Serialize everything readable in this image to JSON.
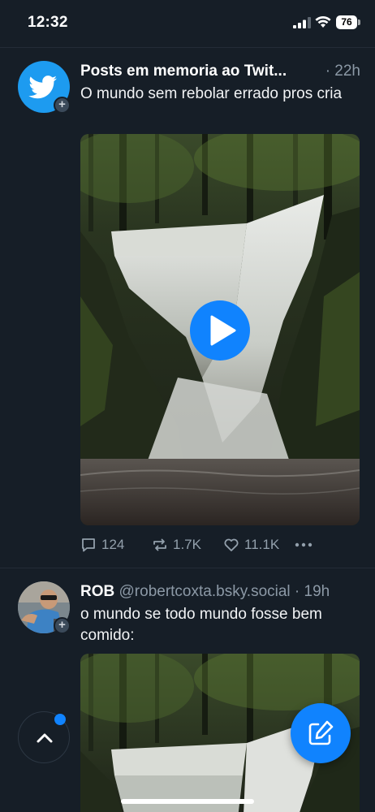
{
  "status_bar": {
    "time": "12:32",
    "battery": "76"
  },
  "posts": [
    {
      "display_name": "Posts em memoria ao Twit...",
      "handle": "",
      "time": "· 22h",
      "text": "O mundo sem rebolar errado pros cria",
      "avatar_icon": "bird-icon",
      "media_type": "video",
      "media_icon": "play-icon",
      "replies": "124",
      "reposts": "1.7K",
      "likes": "11.1K"
    },
    {
      "display_name": "ROB",
      "handle": "@robertcoxta.bsky.social",
      "time": "· 19h",
      "text": "o mundo se todo mundo fosse bem comido:",
      "avatar_icon": "user-photo"
    }
  ],
  "floating": {
    "scroll_top_icon": "chevron-up-icon",
    "compose_icon": "compose-icon"
  },
  "colors": {
    "background": "#161e27",
    "accent": "#1083fe",
    "muted_text": "#8c99a6"
  }
}
